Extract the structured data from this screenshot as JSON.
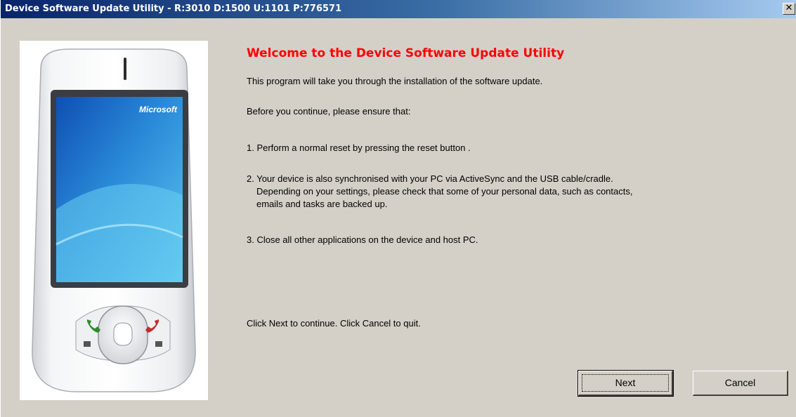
{
  "window": {
    "title": "Device Software Update Utility -  R:3010 D:1500 U:1101 P:776571",
    "close_symbol": "✕"
  },
  "device": {
    "brand": "Microsoft"
  },
  "content": {
    "heading": "Welcome to the Device Software Update Utility",
    "intro": "This program will take you through the installation of the software update.",
    "ensure": "Before you continue, please ensure that:",
    "step1": "1. Perform a normal reset by pressing the reset button .",
    "step2_line1": "2. Your device is also synchronised with your PC via ActiveSync and the USB cable/cradle.",
    "step2_line2": "Depending on your settings, please check that some of your personal data, such as contacts,",
    "step2_line3": "emails and tasks are backed up.",
    "step3": "3. Close all other applications on the device and host PC.",
    "footer": "Click Next to continue. Click Cancel to quit."
  },
  "buttons": {
    "next_label": "Next",
    "cancel_label": "Cancel"
  },
  "colors": {
    "title_bar_start": "#0a246a",
    "title_bar_end": "#a6caf0",
    "heading_red": "#ff0000",
    "dialog_gray": "#d4d0c8"
  }
}
